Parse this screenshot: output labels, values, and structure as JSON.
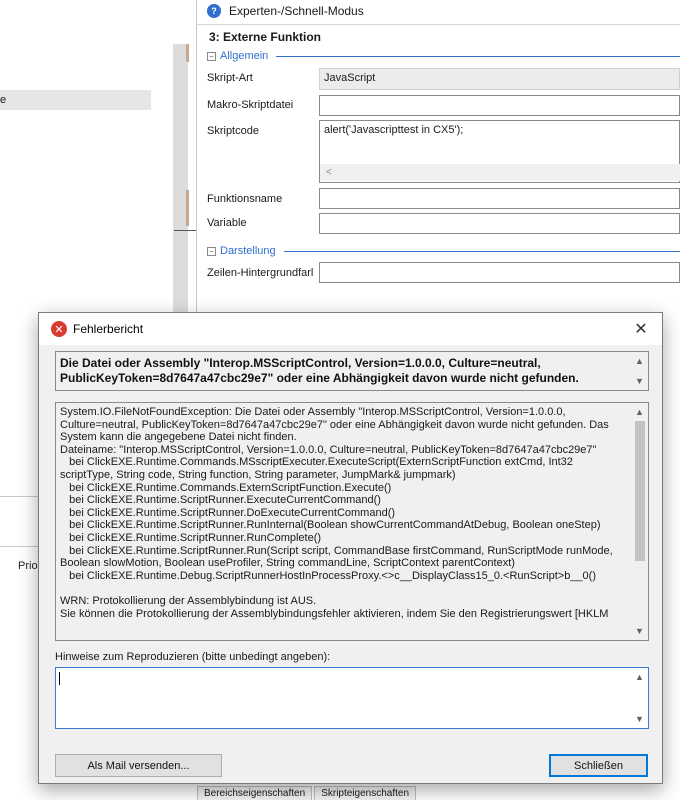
{
  "background": {
    "left_item_text": "e",
    "left_lower_label": "Prio",
    "mode_label": "Experten-/Schnell-Modus",
    "function_title": "3: Externe Funktion",
    "sections": {
      "general": "Allgemein",
      "display": "Darstellung"
    },
    "properties": {
      "script_type_label": "Skript-Art",
      "script_type_value": "JavaScript",
      "macro_file_label": "Makro-Skriptdatei",
      "macro_file_value": "",
      "script_code_label": "Skriptcode",
      "script_code_value": "alert('Javascripttest in CX5');",
      "function_name_label": "Funktionsname",
      "function_name_value": "",
      "variable_label": "Variable",
      "variable_value": "",
      "row_bg_label": "Zeilen-Hintergrundfarl",
      "row_bg_value": ""
    },
    "bottom_tabs": [
      "Bereichseigenschaften",
      "Skripteigenschaften"
    ]
  },
  "dialog": {
    "title": "Fehlerbericht",
    "close_glyph": "✕",
    "summary": "Die Datei oder Assembly \"Interop.MSScriptControl, Version=1.0.0.0, Culture=neutral, PublicKeyToken=8d7647a47cbc29e7\" oder eine Abhängigkeit davon wurde nicht gefunden.",
    "stack_lines": [
      "System.IO.FileNotFoundException: Die Datei oder Assembly \"Interop.MSScriptControl, Version=1.0.0.0, Culture=neutral, PublicKeyToken=8d7647a47cbc29e7\" oder eine Abhängigkeit davon wurde nicht gefunden. Das System kann die angegebene Datei nicht finden.",
      "Dateiname: \"Interop.MSScriptControl, Version=1.0.0.0, Culture=neutral, PublicKeyToken=8d7647a47cbc29e7\"",
      "   bei ClickEXE.Runtime.Commands.MSscriptExecuter.ExecuteScript(ExternScriptFunction extCmd, Int32 scriptType, String code, String function, String parameter, JumpMark& jumpmark)",
      "   bei ClickEXE.Runtime.Commands.ExternScriptFunction.Execute()",
      "   bei ClickEXE.Runtime.ScriptRunner.ExecuteCurrentCommand()",
      "   bei ClickEXE.Runtime.ScriptRunner.DoExecuteCurrentCommand()",
      "   bei ClickEXE.Runtime.ScriptRunner.RunInternal(Boolean showCurrentCommandAtDebug, Boolean oneStep)",
      "   bei ClickEXE.Runtime.ScriptRunner.RunComplete()",
      "   bei ClickEXE.Runtime.ScriptRunner.Run(Script script, CommandBase firstCommand, RunScriptMode runMode, Boolean slowMotion, Boolean useProfiler, String commandLine, ScriptContext parentContext)",
      "   bei ClickEXE.Runtime.Debug.ScriptRunnerHostInProcessProxy.<>c__DisplayClass15_0.<RunScript>b__0()",
      "",
      "WRN: Protokollierung der Assemblybindung ist AUS.",
      "Sie können die Protokollierung der Assemblybindungsfehler aktivieren, indem Sie den Registrierungswert [HKLM"
    ],
    "hint_label": "Hinweise zum Reproduzieren (bitte unbedingt angeben):",
    "hint_value": "",
    "buttons": {
      "mail": "Als Mail versenden...",
      "close": "Schließen"
    }
  },
  "colors": {
    "accent": "#2f6fce",
    "error_icon": "#d83b30",
    "focus_border": "#0078d7",
    "dialog_bg": "#f0f0f0"
  },
  "icons": {
    "mode": "info-circle-icon",
    "error": "error-circle-icon",
    "close": "close-icon",
    "collapse": "collapse-box-icon",
    "scroll_up": "chevron-up-icon",
    "scroll_down": "chevron-down-icon",
    "scroll_left": "chevron-left-icon"
  }
}
